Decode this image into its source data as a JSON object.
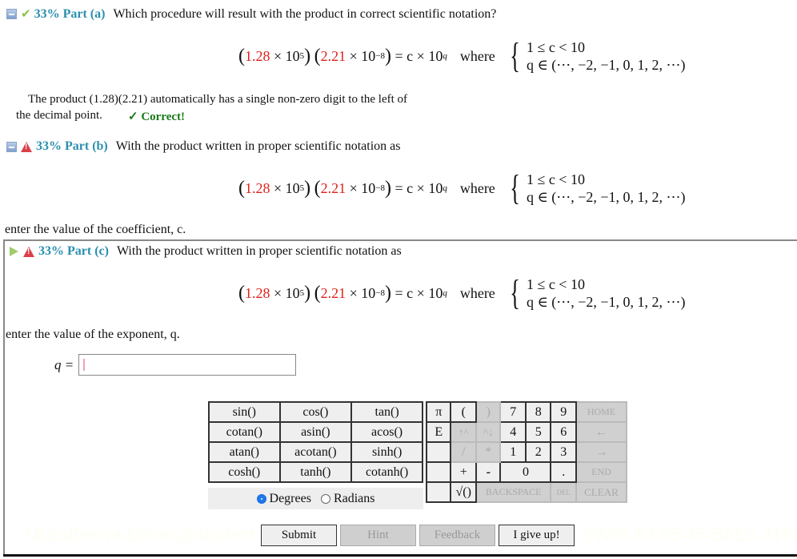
{
  "equation": {
    "coef1": "1.28",
    "exp1": "5",
    "coef2": "2.21",
    "exp2": "−8",
    "rhs": "= c × 10",
    "rhs_exp": "q",
    "where": "where",
    "case1": "1 ≤ c < 10",
    "case2": "q ∈ (⋯, −2, −1, 0, 1, 2, ⋯)"
  },
  "colors": {
    "accent": "#2a8fb0",
    "red": "#e0201a",
    "correct": "#1a7a1a"
  },
  "part_a": {
    "percent_label": "33% Part (a)",
    "question": "Which procedure will result with the product in correct scientific notation?",
    "answer_line1": "The product (1.28)(2.21) automatically has a single non-zero digit to the left of",
    "answer_line2": "the decimal point.",
    "status": "✓ Correct!"
  },
  "part_b": {
    "percent_label": "33% Part (b)",
    "question": "With the product written in proper scientific notation as",
    "prompt": "enter the value of the coefficient, c."
  },
  "part_c": {
    "percent_label": "33% Part (c)",
    "question": "With the product written in proper scientific notation as",
    "prompt": "enter the value of the exponent, q.",
    "input_label": "q =",
    "input_value": ""
  },
  "keypad": {
    "functions": [
      [
        "sin()",
        "cos()",
        "tan()"
      ],
      [
        "cotan()",
        "asin()",
        "acos()"
      ],
      [
        "atan()",
        "acotan()",
        "sinh()"
      ],
      [
        "cosh()",
        "tanh()",
        "cotanh()"
      ]
    ],
    "angle_modes": [
      "Degrees",
      "Radians"
    ],
    "selected_mode": "Degrees",
    "pi": "π",
    "lparen": "(",
    "rparen": ")",
    "e": "E",
    "up": "↑^",
    "down": "^↓",
    "div": "/",
    "mul": "*",
    "plus": "+",
    "minus": "-",
    "sqrt": "√()",
    "digits": [
      "7",
      "8",
      "9",
      "4",
      "5",
      "6",
      "1",
      "2",
      "3",
      "0",
      "."
    ],
    "home": "HOME",
    "left": "←",
    "right": "→",
    "end": "END",
    "backspace": "BACKSPACE",
    "del": "DEL",
    "clear": "CLEAR"
  },
  "buttons": {
    "submit": "Submit",
    "hint": "Hint",
    "feedback": "Feedback",
    "giveup": "I give up!"
  },
  "watermark": {
    "left": "Muzaffarova.Dinara@student.c",
    "right": "9W05-5J-05-45-BAE0-41938"
  }
}
